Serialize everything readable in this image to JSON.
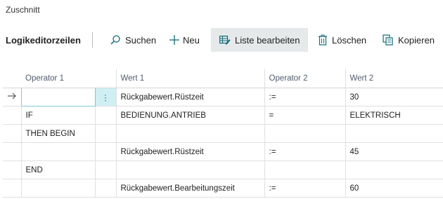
{
  "page": {
    "title": "Zuschnitt"
  },
  "toolbar": {
    "title": "Logikeditorzeilen",
    "buttons": [
      {
        "label": "Suchen",
        "icon": "search-icon"
      },
      {
        "label": "Neu",
        "icon": "plus-icon"
      },
      {
        "label": "Liste bearbeiten",
        "icon": "edit-list-icon"
      },
      {
        "label": "Löschen",
        "icon": "trash-icon"
      },
      {
        "label": "Kopieren",
        "icon": "copy-icon"
      }
    ]
  },
  "grid": {
    "columns": [
      "Operator 1",
      "Wert 1",
      "Operator 2",
      "Wert 2"
    ],
    "rows": [
      {
        "op1": "",
        "wert1": "Rückgabewert.Rüstzeit",
        "op2": ":=",
        "wert2": "30",
        "selected": true
      },
      {
        "op1": "IF",
        "wert1": "BEDIENUNG.ANTRIEB",
        "op2": "=",
        "wert2": "ELEKTRISCH"
      },
      {
        "op1": "THEN BEGIN",
        "wert1": "",
        "op2": "",
        "wert2": ""
      },
      {
        "op1": "",
        "wert1": "Rückgabewert.Rüstzeit",
        "op2": ":=",
        "wert2": "45"
      },
      {
        "op1": "END",
        "wert1": "",
        "op2": "",
        "wert2": ""
      },
      {
        "op1": "",
        "wert1": "Rückgabewert.Bearbeitungszeit",
        "op2": ":=",
        "wert2": "60"
      }
    ]
  },
  "colors": {
    "accent": "#0f6c7a",
    "selected_bg": "#cfeff4",
    "active_button_bg": "#e6e9ea"
  }
}
